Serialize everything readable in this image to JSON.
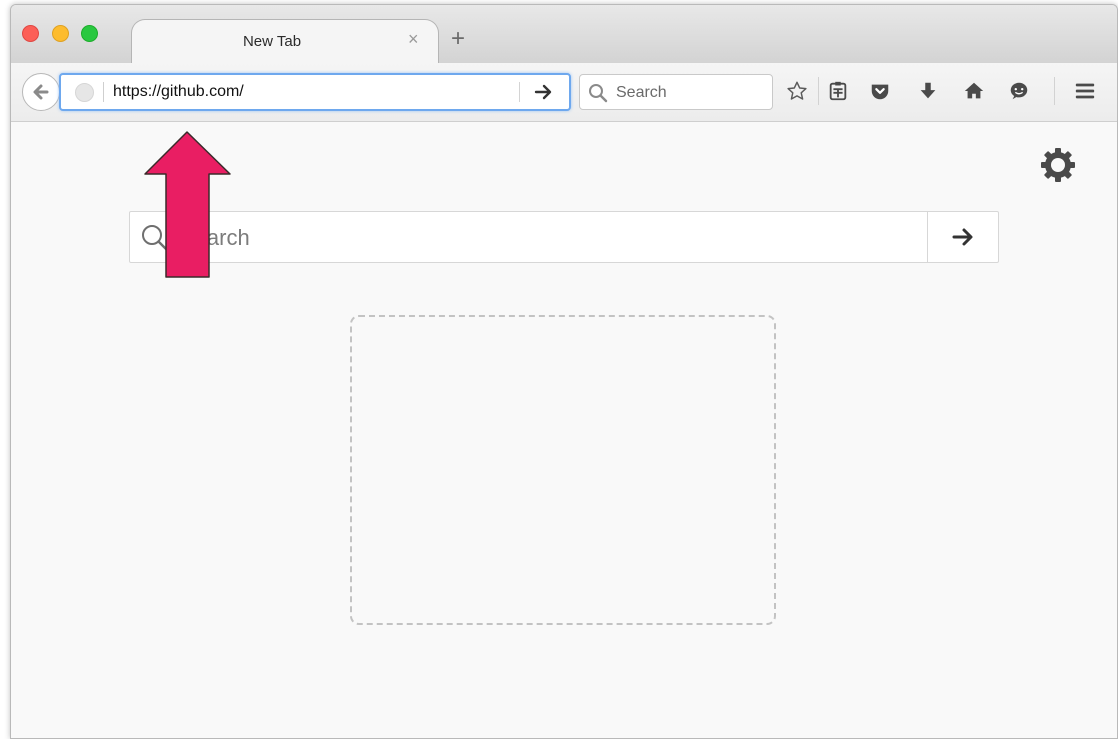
{
  "tab": {
    "title": "New Tab",
    "close_glyph": "×"
  },
  "new_tab_glyph": "+",
  "url_bar": {
    "url": "https://github.com/"
  },
  "toolbar_search": {
    "placeholder": "Search"
  },
  "toolbar_icons": [
    "star-icon",
    "reading-list-icon",
    "pocket-icon",
    "download-icon",
    "home-icon",
    "chat-icon",
    "menu-icon"
  ],
  "newtab_search": {
    "placeholder": "Search"
  },
  "annotation": {
    "arrow_color": "#e91e63"
  },
  "colors": {
    "urlbar_focus": "#6ea8ee"
  }
}
